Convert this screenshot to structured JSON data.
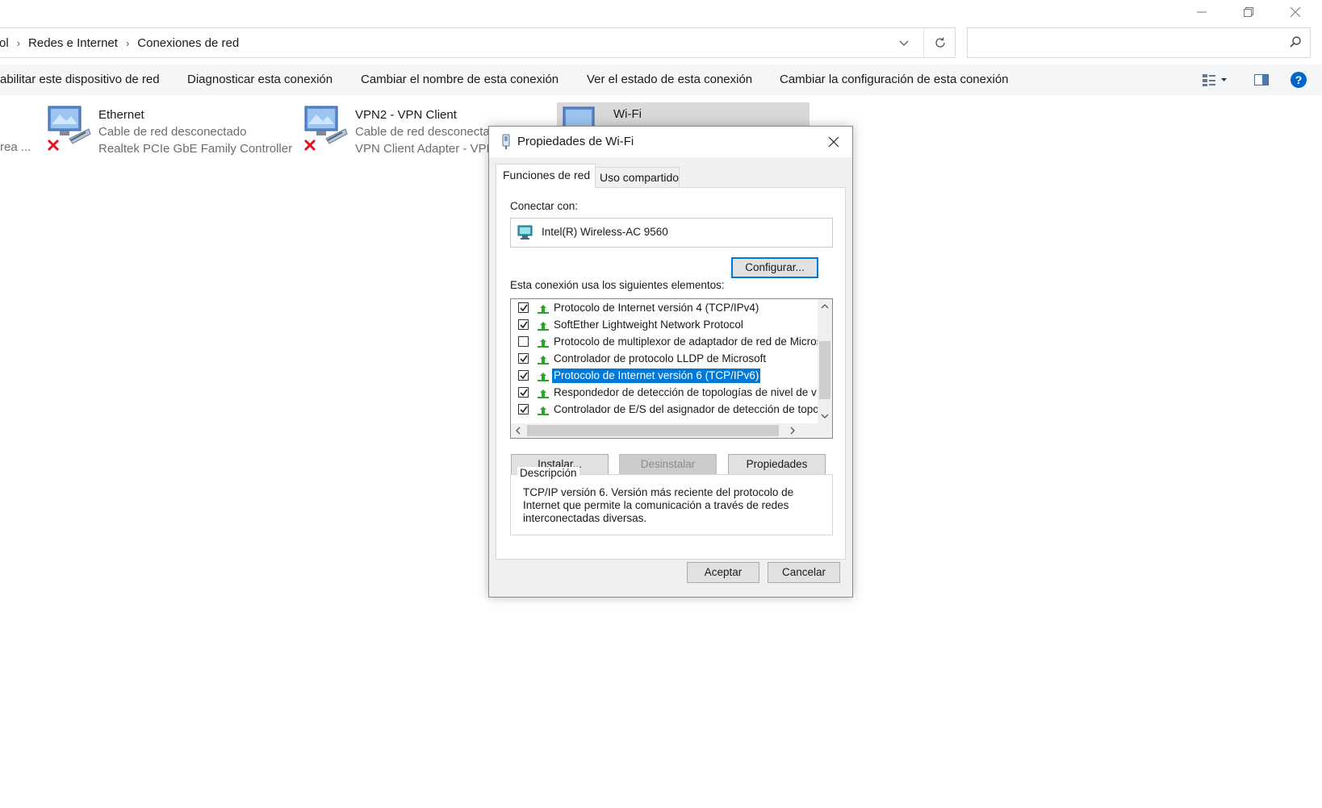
{
  "breadcrumb": {
    "items": [
      "ol",
      "Redes e Internet",
      "Conexiones de red"
    ]
  },
  "search": {
    "placeholder": ""
  },
  "commands": {
    "disable": "abilitar este dispositivo de red",
    "diagnose": "Diagnosticar esta conexión",
    "rename": "Cambiar el nombre de esta conexión",
    "status": "Ver el estado de esta conexión",
    "settings": "Cambiar la configuración de esta conexión"
  },
  "left_fragment": "rea ...",
  "connections": [
    {
      "name": "Ethernet",
      "status": "Cable de red desconectado",
      "device": "Realtek PCIe GbE Family Controller"
    },
    {
      "name": "VPN2 - VPN Client",
      "status": "Cable de red desconecta",
      "device": "VPN Client Adapter - VPN"
    },
    {
      "name": "Wi-Fi"
    }
  ],
  "dialog": {
    "title": "Propiedades de Wi-Fi",
    "tabs": [
      "Funciones de red",
      "Uso compartido"
    ],
    "connect_label": "Conectar con:",
    "adapter": "Intel(R) Wireless-AC 9560",
    "configure_button": "Configurar...",
    "items_label": "Esta conexión usa los siguientes elementos:",
    "items": [
      {
        "label": "Protocolo de Internet versión 4 (TCP/IPv4)",
        "checked": true
      },
      {
        "label": "SoftEther Lightweight Network Protocol",
        "checked": true
      },
      {
        "label": "Protocolo de multiplexor de adaptador de red de Micros",
        "checked": false
      },
      {
        "label": "Controlador de protocolo LLDP de Microsoft",
        "checked": true
      },
      {
        "label": "Protocolo de Internet versión 6 (TCP/IPv6)",
        "checked": true
      },
      {
        "label": "Respondedor de detección de topologías de nivel de v",
        "checked": true
      },
      {
        "label": "Controlador de E/S del asignador de detección de topc",
        "checked": true
      }
    ],
    "selected_item": "Protocolo de Internet versión 6 (TCP/IPv6)",
    "install_button": "Instalar...",
    "uninstall_button": "Desinstalar",
    "properties_button": "Propiedades",
    "description_legend": "Descripción",
    "description_text": "TCP/IP versión 6. Versión más reciente del protocolo de Internet que permite la comunicación a través de redes interconectadas diversas.",
    "ok_button": "Aceptar",
    "cancel_button": "Cancelar"
  },
  "colors": {
    "accent": "#0078d7",
    "help": "#0066cc",
    "error": "#e81123",
    "protocol_green": "#2aa52a"
  },
  "icons": [
    "minimize-icon",
    "restore-icon",
    "close-icon",
    "chevron-right-icon",
    "chevron-down-icon",
    "refresh-icon",
    "search-icon",
    "view-options-icon",
    "preview-pane-icon",
    "help-icon",
    "network-adapter-icon",
    "disconnected-x-icon",
    "network-protocol-icon",
    "wifi-properties-icon"
  ]
}
